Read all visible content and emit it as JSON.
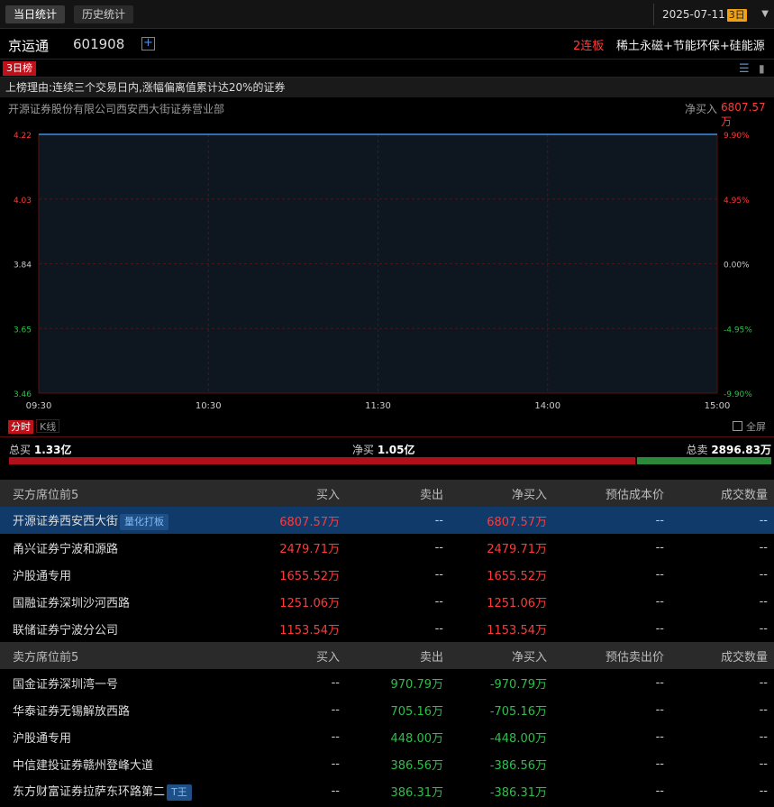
{
  "tabs": {
    "today": "当日统计",
    "history": "历史统计"
  },
  "date": {
    "value": "2025-07-11",
    "days": "3日"
  },
  "stock": {
    "name": "京运通",
    "code": "601908",
    "add_icon": "+",
    "streak": "2连板",
    "concepts": "稀土永磁+节能环保+硅能源"
  },
  "rank_tab": "3日榜",
  "reason": "上榜理由:连续三个交易日内,涨幅偏离值累计达20%的证券",
  "seat": {
    "name": "开源证券股份有限公司西安西大街证券营业部",
    "netbuy_label": "净买入",
    "netbuy_value": "6807.57万"
  },
  "chart_data": {
    "type": "line",
    "x_ticks": [
      "09:30",
      "10:30",
      "11:30",
      "14:00",
      "15:00"
    ],
    "y_ticks": [
      "4.22",
      "4.03",
      "3.84",
      "3.65",
      "3.46"
    ],
    "pct_ticks": [
      "9.90%",
      "4.95%",
      "0.00%",
      "-4.95%",
      "-9.90%"
    ],
    "ylim": [
      3.46,
      4.22
    ],
    "series": [
      {
        "x": [
          "09:30",
          "15:00"
        ],
        "values": [
          4.22,
          4.22
        ]
      }
    ],
    "colors": {
      "line": "#3a8ee8",
      "red": "#ff3a3a",
      "green": "#2cc04a",
      "neutral": "#ccc",
      "grid": "#5a1010"
    }
  },
  "chart_tabs": {
    "timeshare": "分时",
    "kline": "K线",
    "fullscreen": "全屏"
  },
  "totals": {
    "buy_label": "总买",
    "buy_value": "1.33亿",
    "net_label": "净买",
    "net_value": "1.05亿",
    "sell_label": "总卖",
    "sell_value": "2896.83万",
    "buy_ratio": 0.823
  },
  "buy_table": {
    "headers": [
      "买方席位前5",
      "买入",
      "卖出",
      "净买入",
      "预估成本价",
      "成交数量"
    ],
    "rows": [
      {
        "name": "开源证券西安西大街",
        "tag": "量化打板",
        "buy": "6807.57万",
        "sell": "--",
        "net": "6807.57万",
        "cost": "--",
        "qty": "--"
      },
      {
        "name": "甬兴证券宁波和源路",
        "tag": "",
        "buy": "2479.71万",
        "sell": "--",
        "net": "2479.71万",
        "cost": "--",
        "qty": "--"
      },
      {
        "name": "沪股通专用",
        "tag": "",
        "buy": "1655.52万",
        "sell": "--",
        "net": "1655.52万",
        "cost": "--",
        "qty": "--"
      },
      {
        "name": "国融证券深圳沙河西路",
        "tag": "",
        "buy": "1251.06万",
        "sell": "--",
        "net": "1251.06万",
        "cost": "--",
        "qty": "--"
      },
      {
        "name": "联储证券宁波分公司",
        "tag": "",
        "buy": "1153.54万",
        "sell": "--",
        "net": "1153.54万",
        "cost": "--",
        "qty": "--"
      }
    ]
  },
  "sell_table": {
    "headers": [
      "卖方席位前5",
      "买入",
      "卖出",
      "净买入",
      "预估卖出价",
      "成交数量"
    ],
    "rows": [
      {
        "name": "国金证券深圳湾一号",
        "tag": "",
        "buy": "--",
        "sell": "970.79万",
        "net": "-970.79万",
        "cost": "--",
        "qty": "--"
      },
      {
        "name": "华泰证券无锡解放西路",
        "tag": "",
        "buy": "--",
        "sell": "705.16万",
        "net": "-705.16万",
        "cost": "--",
        "qty": "--"
      },
      {
        "name": "沪股通专用",
        "tag": "",
        "buy": "--",
        "sell": "448.00万",
        "net": "-448.00万",
        "cost": "--",
        "qty": "--"
      },
      {
        "name": "中信建投证券赣州登峰大道",
        "tag": "",
        "buy": "--",
        "sell": "386.56万",
        "net": "-386.56万",
        "cost": "--",
        "qty": "--"
      },
      {
        "name": "东方财富证券拉萨东环路第二",
        "tag": "T王",
        "buy": "--",
        "sell": "386.31万",
        "net": "-386.31万",
        "cost": "--",
        "qty": "--"
      }
    ]
  }
}
